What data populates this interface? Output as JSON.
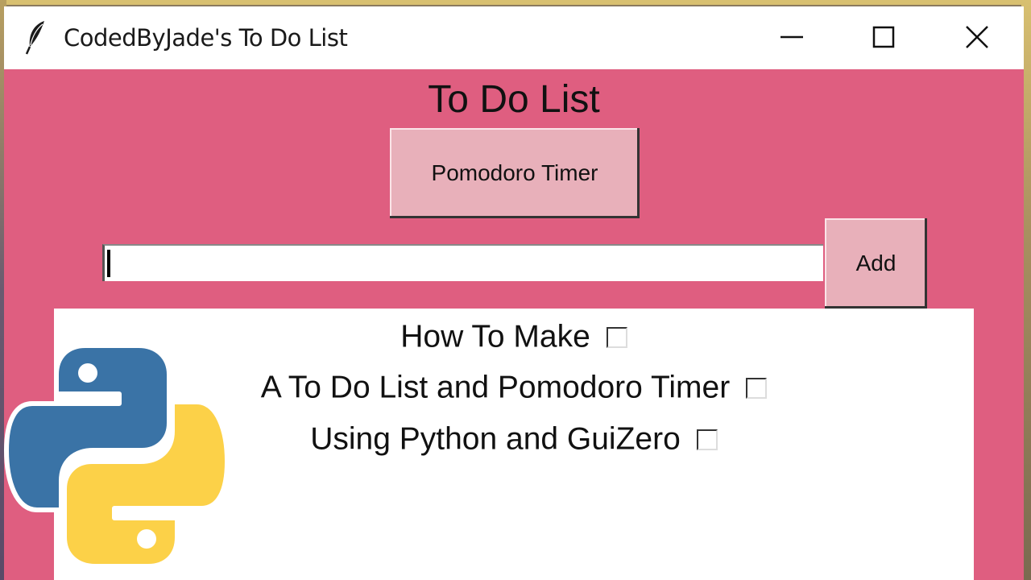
{
  "window": {
    "title": "CodedByJade's To Do List",
    "background_color": "#df5e80"
  },
  "app": {
    "heading": "To Do List",
    "pomodoro_button": "Pomodoro Timer",
    "task_input": {
      "value": "",
      "placeholder": ""
    },
    "add_button": "Add"
  },
  "tasks": [
    {
      "label": "How To Make",
      "checked": false
    },
    {
      "label": "A To Do List and Pomodoro Timer",
      "checked": false
    },
    {
      "label": "Using Python and GuiZero",
      "checked": false
    }
  ],
  "icons": {
    "app": "feather-icon",
    "minimize": "minimize-icon",
    "maximize": "maximize-icon",
    "close": "close-icon",
    "logo": "python-logo"
  },
  "colors": {
    "button": "#e8b0ba",
    "python_blue": "#3a73a6",
    "python_yellow": "#fcd148"
  }
}
